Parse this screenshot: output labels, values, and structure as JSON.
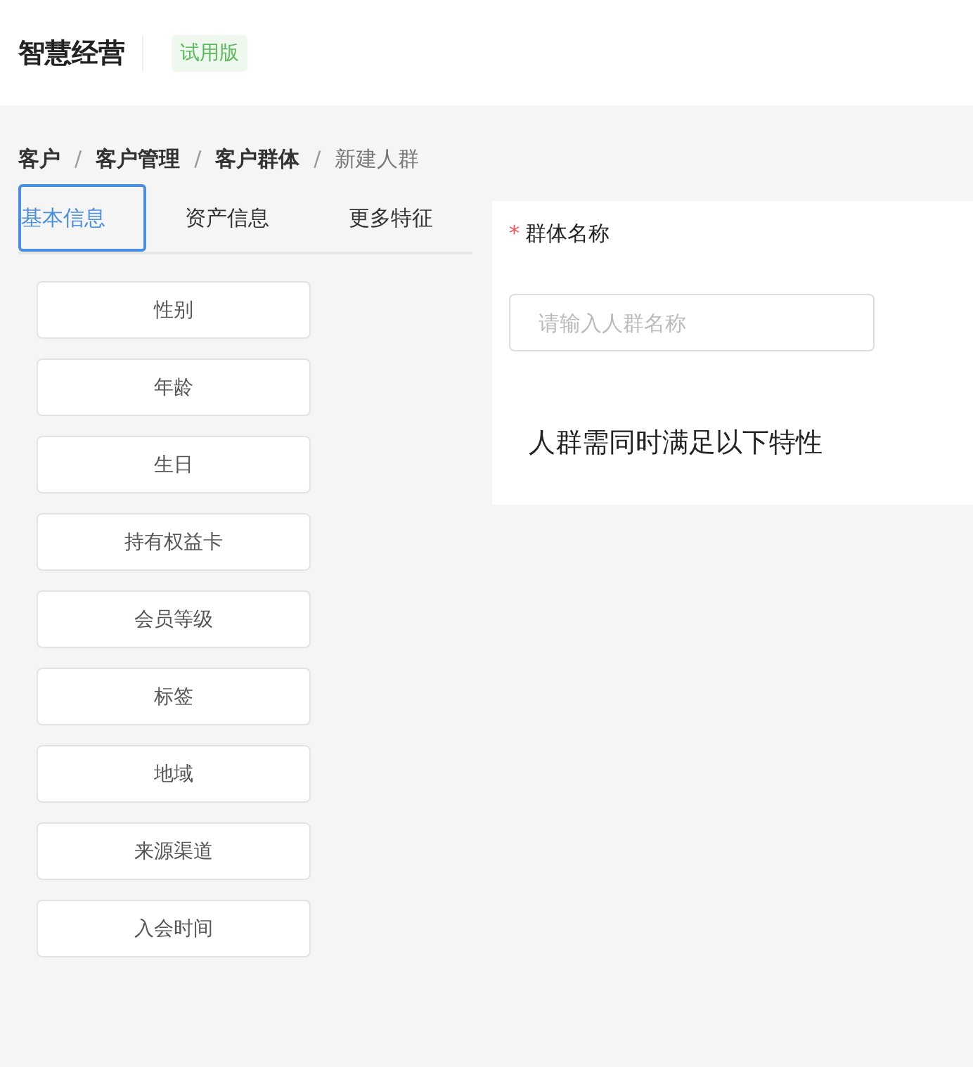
{
  "header": {
    "title": "智慧经营",
    "badge": "试用版"
  },
  "breadcrumb": [
    {
      "label": "客户",
      "current": false
    },
    {
      "label": "客户管理",
      "current": false
    },
    {
      "label": "客户群体",
      "current": false
    },
    {
      "label": "新建人群",
      "current": true
    }
  ],
  "separator": "/",
  "tabs": [
    {
      "label": "基本信息",
      "selected": true
    },
    {
      "label": "资产信息",
      "selected": false
    },
    {
      "label": "更多特征",
      "selected": false
    }
  ],
  "features": [
    "性别",
    "年龄",
    "生日",
    "持有权益卡",
    "会员等级",
    "标签",
    "地域",
    "来源渠道",
    "入会时间"
  ],
  "form": {
    "label": "群体名称",
    "required": true,
    "required_mark": "*",
    "placeholder": "请输入人群名称",
    "condition_title": "人群需同时满足以下特性"
  }
}
